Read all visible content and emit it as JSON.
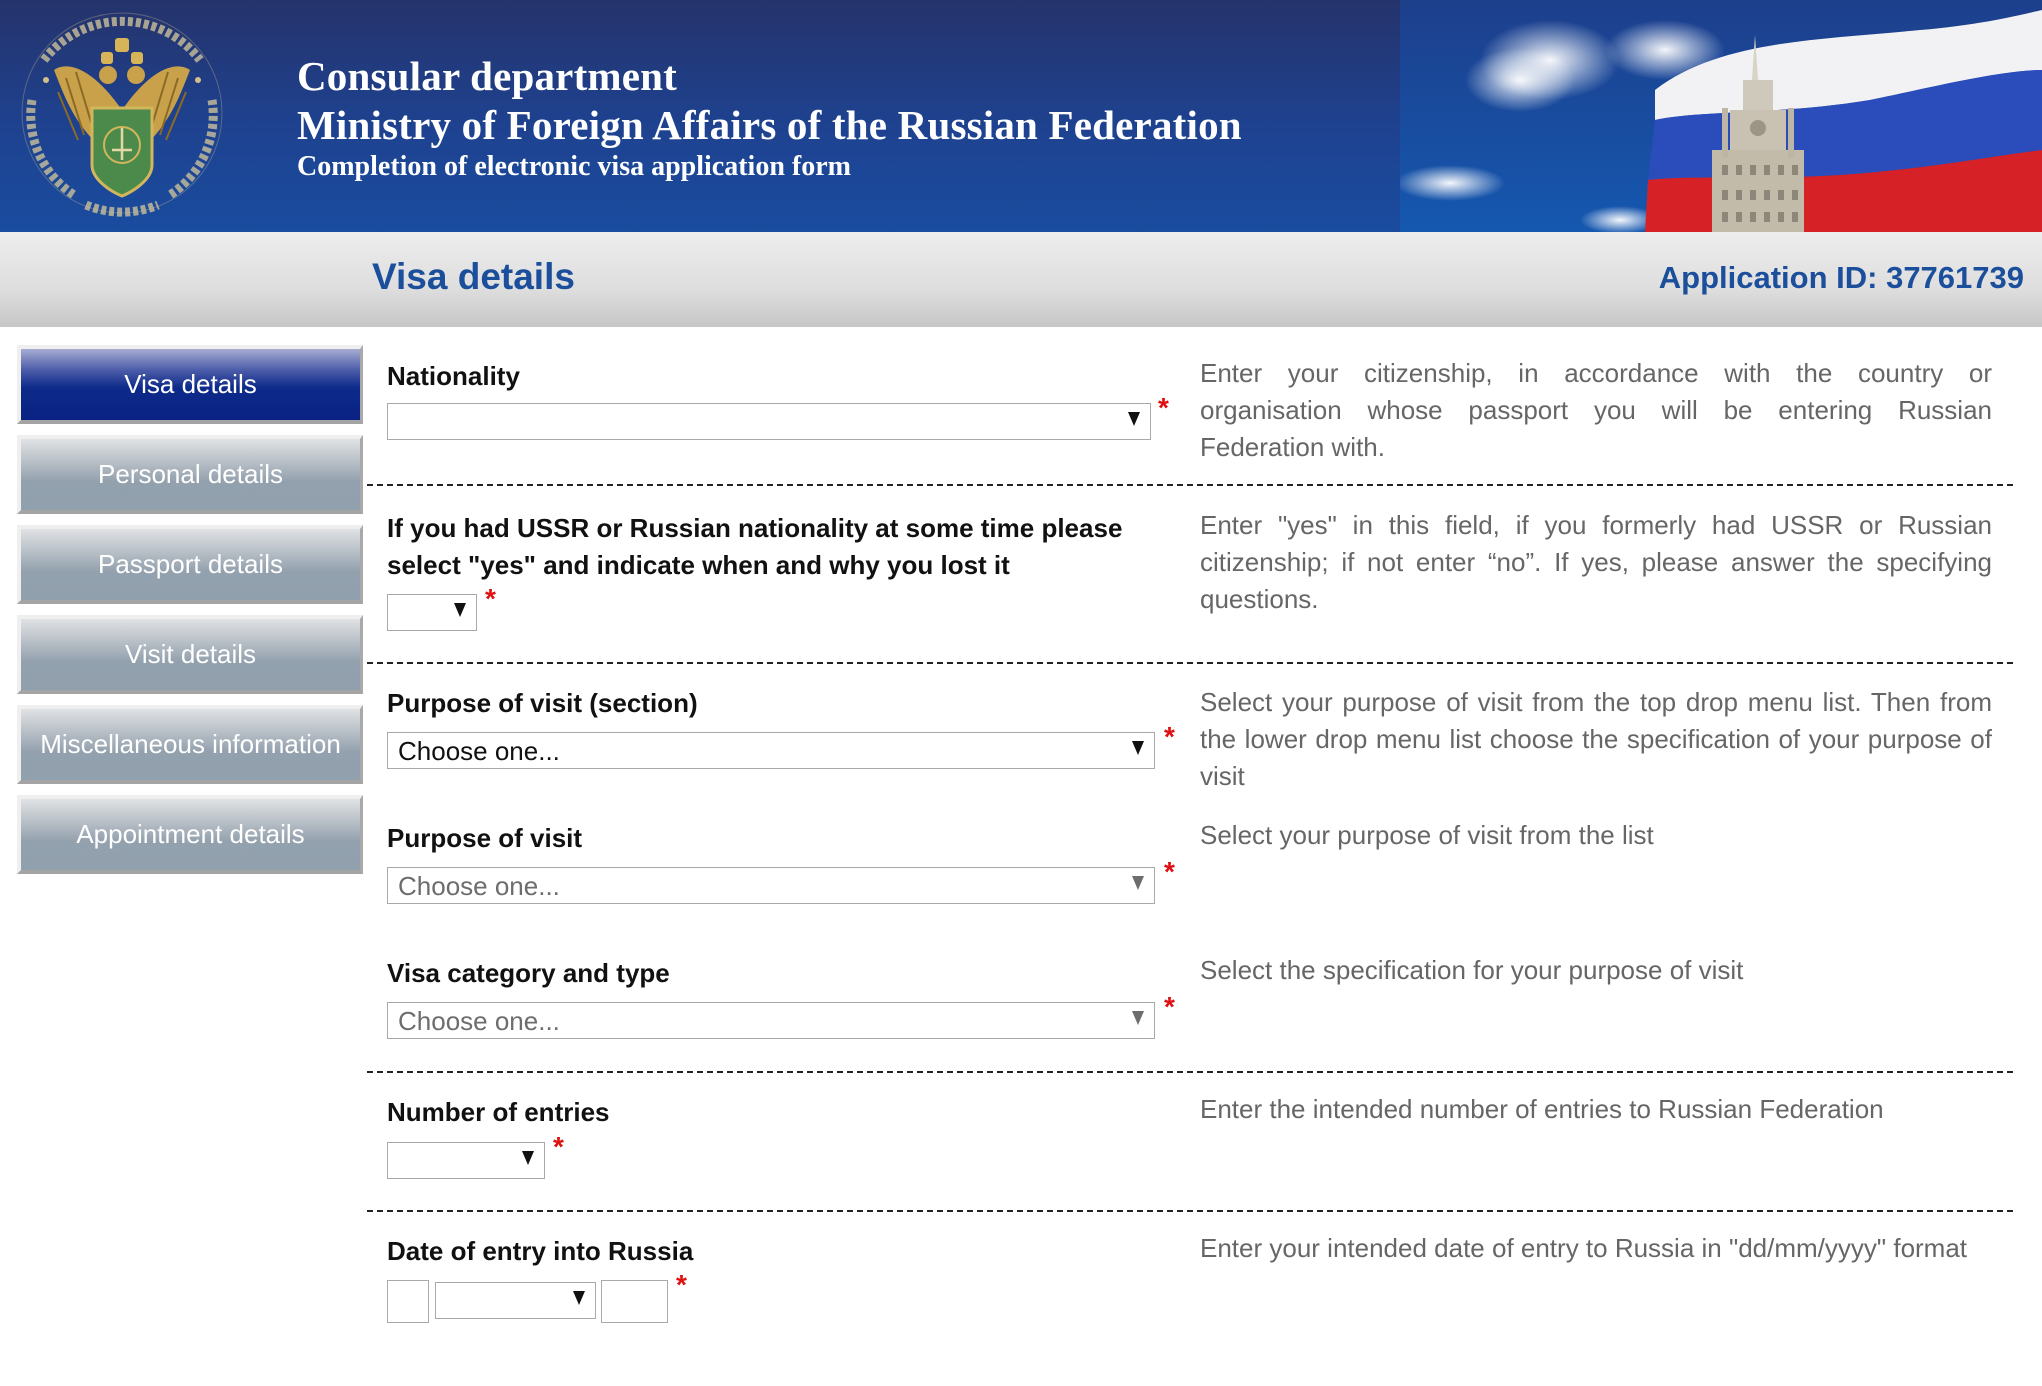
{
  "header": {
    "line1": "Consular department",
    "line2": "Ministry of Foreign Affairs of the Russian Federation",
    "line3": "Completion of electronic visa application form",
    "emblem_icon": "consular-department-emblem",
    "banner_image": "russian-flag-and-mfa-building"
  },
  "titlebar": {
    "page_title": "Visa details",
    "application_id": "Application ID: 37761739"
  },
  "sidebar": {
    "items": [
      {
        "label": "Visa details",
        "active": true
      },
      {
        "label": "Personal details",
        "active": false
      },
      {
        "label": "Passport details",
        "active": false
      },
      {
        "label": "Visit details",
        "active": false
      },
      {
        "label": "Miscellaneous information",
        "active": false
      },
      {
        "label": "Appointment details",
        "active": false
      }
    ]
  },
  "form": {
    "required_marker": "*",
    "nationality": {
      "label": "Nationality",
      "value": "",
      "help": "Enter your citizenship, in accordance with the country or organisation whose passport you will be entering Russian Federation with."
    },
    "former_nationality": {
      "label_line1": "If you had USSR or Russian nationality at some time please",
      "label_line2": "select \"yes\" and indicate when and why you lost it",
      "value": "",
      "help": "Enter \"yes\" in this field, if you formerly had USSR or Russian citizenship; if not enter “no”. If yes, please answer the specifying questions."
    },
    "purpose_section": {
      "label": "Purpose of visit (section)",
      "value": "Choose one...",
      "help": "Select your purpose of visit from the top drop menu list. Then from the lower drop menu list choose the specification of your purpose of visit"
    },
    "purpose": {
      "label": "Purpose of visit",
      "value": "Choose one...",
      "help": "Select your purpose of visit from the list",
      "disabled": true
    },
    "visa_category": {
      "label": "Visa category and type",
      "value": "Choose one...",
      "help": "Select the specification for your purpose of visit",
      "disabled": true
    },
    "entries": {
      "label": "Number of entries",
      "value": "",
      "help": "Enter the intended number of entries to Russian Federation"
    },
    "entry_date": {
      "label": "Date of entry into Russia",
      "day": "",
      "month": "",
      "year": "",
      "help": "Enter your intended date of entry to Russia in \"dd/mm/yyyy\" format"
    }
  },
  "colors": {
    "accent_blue": "#1b4e9b",
    "active_nav": "#0a2283",
    "inactive_nav": "#91a0ad",
    "required": "#e01010",
    "help_text": "#666666"
  }
}
